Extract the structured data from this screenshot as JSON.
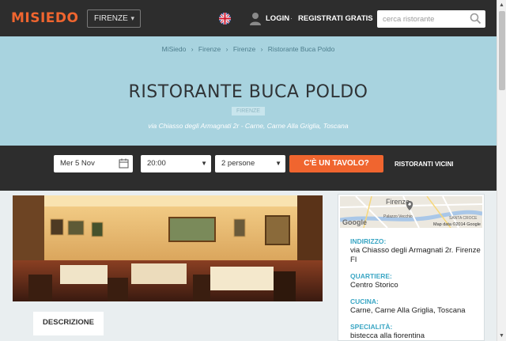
{
  "header": {
    "logo_text": "MISIEDO",
    "city": "FIRENZE",
    "login": "LOGIN",
    "separator": "·",
    "register": "REGISTRATI GRATIS",
    "search_placeholder": "cerca ristorante"
  },
  "hero": {
    "breadcrumb": [
      "MiSiedo",
      "Firenze",
      "Firenze",
      "Ristorante Buca Poldo"
    ],
    "breadcrumb_separator": "›",
    "title": "RISTORANTE BUCA POLDO",
    "city_badge": "FIRENZE",
    "address_line": "via Chiasso degli Armagnati 2r - Carne, Carne Alla Griglia, Toscana"
  },
  "booking": {
    "date": "Mer 5 Nov",
    "time": "20:00",
    "people": "2 persone",
    "cta": "C'È UN TAVOLO?",
    "nearby": "RISTORANTI VICINI"
  },
  "tabs": {
    "description": "DESCRIZIONE"
  },
  "info": {
    "map_city_label": "Firenze",
    "map_poi": "Palazzo Vecchio",
    "map_area": "SANTA CROCE",
    "map_google": "Google",
    "map_credit": "Map data ©2014 Google",
    "items": [
      {
        "label": "INDIRIZZO:",
        "value": "via Chiasso degli Armagnati 2r. Firenze FI"
      },
      {
        "label": "QUARTIERE:",
        "value": "Centro Storico"
      },
      {
        "label": "CUCINA:",
        "value": "Carne, Carne Alla Griglia, Toscana"
      },
      {
        "label": "SPECIALITÀ:",
        "value": "bistecca alla fiorentina"
      }
    ]
  },
  "colors": {
    "accent": "#f0652f",
    "header_bg": "#2d2d2d",
    "hero_bg": "#a8d3df",
    "info_label": "#3aa6c4"
  },
  "icons": [
    "uk-flag-icon",
    "user-icon",
    "search-icon",
    "calendar-icon",
    "chevron-down-icon"
  ]
}
